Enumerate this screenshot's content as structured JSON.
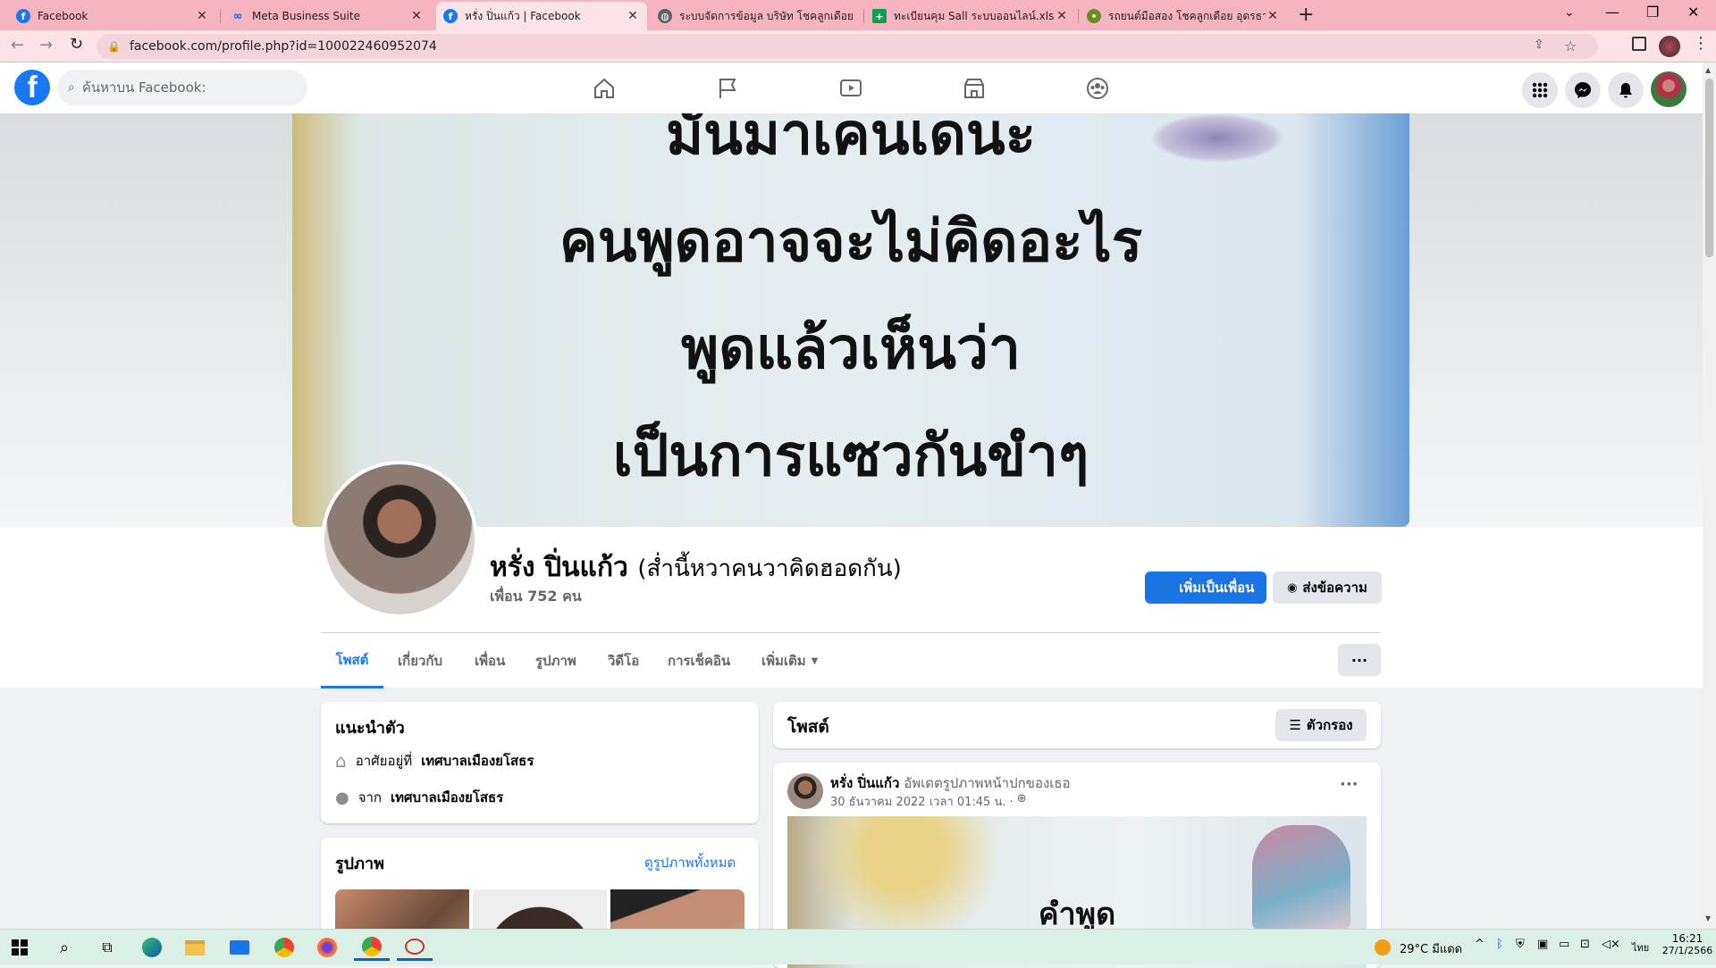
{
  "browser": {
    "tabs": [
      {
        "title": "Facebook",
        "icon": "facebook-icon",
        "color": "#1877f2"
      },
      {
        "title": "Meta Business Suite",
        "icon": "meta-icon",
        "color": "#0668e1"
      },
      {
        "title": "หรั่ง ปิ่นแก้ว | Facebook",
        "icon": "facebook-icon",
        "color": "#1877f2"
      },
      {
        "title": "ระบบจัดการข้อมูล บริษัท โชคลูกเดือย อ",
        "icon": "globe-icon",
        "color": "#5f6368"
      },
      {
        "title": "ทะเบียนคุม Sall ระบบออนไลน์.xlsx - G",
        "icon": "sheets-icon",
        "color": "#0f9d58"
      },
      {
        "title": "รถยนต์มือสอง โชคลูกเดือย อุดรธานี",
        "icon": "site-icon",
        "color": "#6b8e23"
      }
    ],
    "url": "facebook.com/profile.php?id=100022460952074"
  },
  "fb": {
    "search_placeholder": "ค้นหาบน Facebook:"
  },
  "cover": {
    "lines": [
      "มันมาเคนเดนะ",
      "คนพูดอาจจะไม่คิดอะไร",
      "พูดแล้วเห็นว่า",
      "เป็นการแซวกันขำๆ"
    ]
  },
  "profile": {
    "name": "หรั่ง ปิ่นแก้ว",
    "alt_name": "(ส่ำนี้หวาคนวาคิดฮอดกัน)",
    "friends": "เพื่อน 752 คน",
    "add_friend": "เพิ่มเป็นเพื่อน",
    "message": "ส่งข้อความ"
  },
  "profile_tabs": [
    "โพสต์",
    "เกี่ยวกับ",
    "เพื่อน",
    "รูปภาพ",
    "วิดีโอ",
    "การเช็คอิน",
    "เพิ่มเติม"
  ],
  "intro": {
    "title": "แนะนำตัว",
    "lives_prefix": "อาศัยอยู่ที่",
    "lives_place": "เทศบาลเมืองยโสธร",
    "from_prefix": "จาก",
    "from_place": "เทศบาลเมืองยโสธร"
  },
  "photos": {
    "title": "รูปภาพ",
    "see_all": "ดูรูปภาพทั้งหมด"
  },
  "posts": {
    "title": "โพสต์",
    "filter": "ตัวกรอง",
    "author": "หรั่ง ปิ่นแก้ว",
    "action": "อัพเดตรูปภาพหน้าปกของเธอ",
    "time": "30 ธันวาคม 2022 เวลา 01:45 น. ·",
    "image_text": "คำพูด"
  },
  "taskbar": {
    "weather": "29°C  มีแดด",
    "lang": "ไทย",
    "time": "16:21",
    "date": "27/1/2566"
  }
}
